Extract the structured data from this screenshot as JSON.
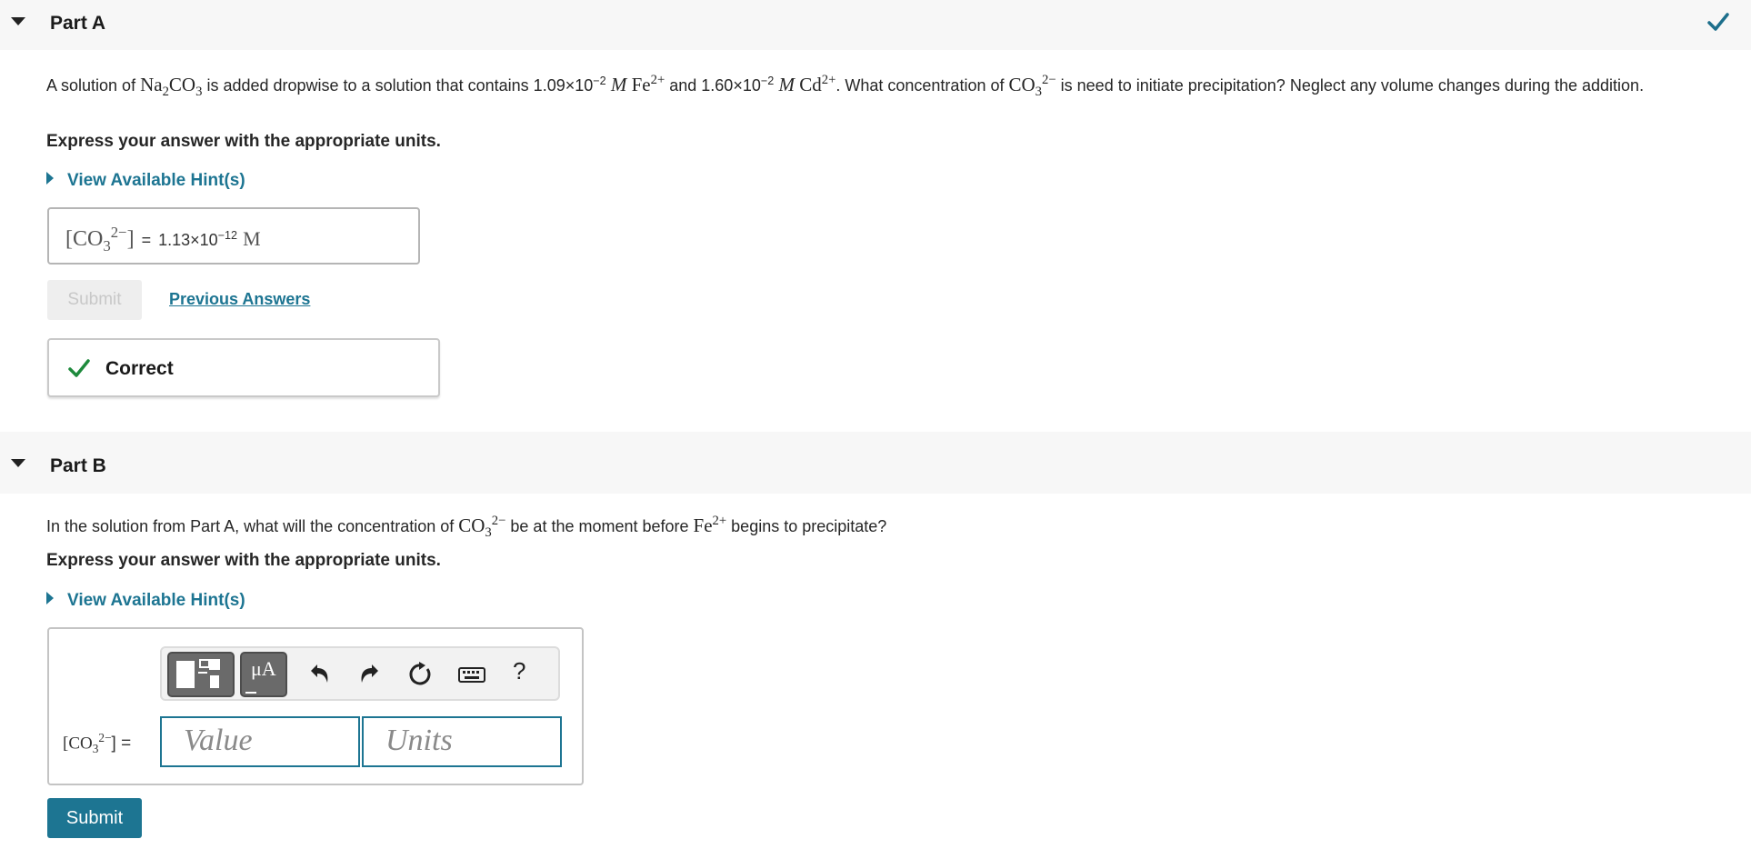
{
  "partA": {
    "title": "Part A",
    "question": {
      "t1": "A solution of ",
      "reagent": "Na",
      "reagent_sub1": "2",
      "reagent_mid": "CO",
      "reagent_sub2": "3",
      "t2": " is added dropwise to a solution that contains 1.09×10",
      "exp1": "−2",
      "unit1": " M ",
      "ion1": "Fe",
      "ion1_sup": "2+",
      "t3": " and 1.60×10",
      "exp2": "−2",
      "unit2": " M ",
      "ion2": "Cd",
      "ion2_sup": "2+",
      "t4": ". What concentration of ",
      "ion3": "CO",
      "ion3_sub": "3",
      "ion3_sup": "2−",
      "t5": " is need to initiate precipitation? Neglect any volume changes during the addition."
    },
    "instruction": "Express your answer with the appropriate units.",
    "hint_label": "View Available Hint(s)",
    "answer": {
      "lbracket": "[CO",
      "sub": "3",
      "sup": "2−",
      "rbracket": "]",
      "equals": "=",
      "value": "1.13×10",
      "value_exp": "−12",
      "unit": "M"
    },
    "submit_label": "Submit",
    "previous_answers_label": "Previous Answers",
    "feedback": "Correct"
  },
  "partB": {
    "title": "Part B",
    "question": {
      "t1": "In the solution from Part A, what will the concentration of ",
      "ion1": "CO",
      "ion1_sub": "3",
      "ion1_sup": "2−",
      "t2": " be at the moment before ",
      "ion2": "Fe",
      "ion2_sup": "2+",
      "t3": " begins to precipitate?"
    },
    "instruction": "Express your answer with the appropriate units.",
    "hint_label": "View Available Hint(s)",
    "toolbar": {
      "mu_label": "μA",
      "help_label": "?"
    },
    "input_label": {
      "lbracket": "[CO",
      "sub": "3",
      "sup": "2−",
      "rbracket": "] ="
    },
    "value_placeholder": "Value",
    "units_placeholder": "Units",
    "submit_label": "Submit"
  },
  "colors": {
    "accent": "#1d7592",
    "correct_green": "#1e8a3c",
    "header_bg": "#f7f7f7"
  }
}
